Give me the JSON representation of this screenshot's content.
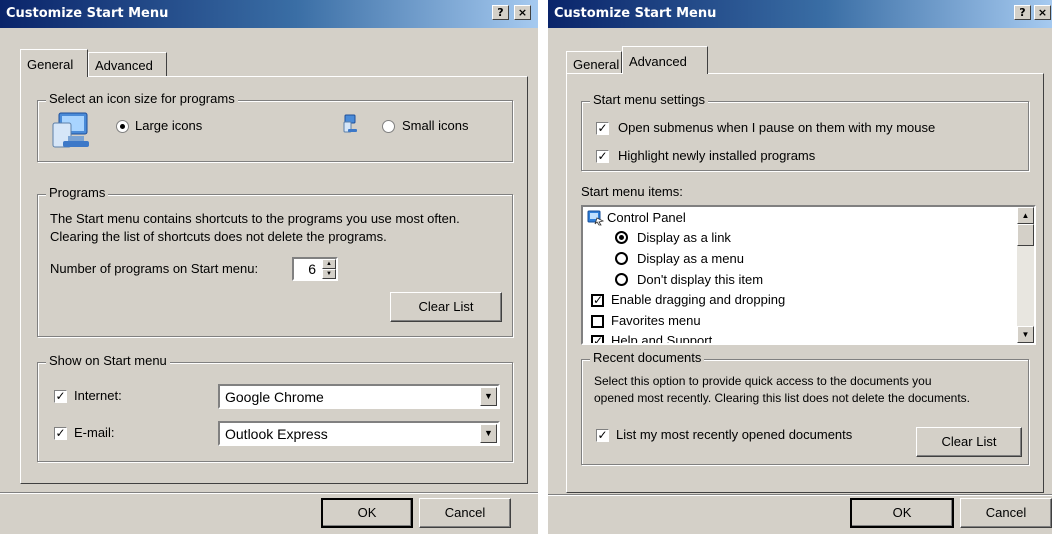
{
  "left": {
    "title": "Customize Start Menu",
    "help_btn": "?",
    "close_btn": "×",
    "tabs": [
      "General",
      "Advanced"
    ],
    "icon_size": {
      "legend": "Select an icon size for programs",
      "large_label": "Large icons",
      "small_label": "Small icons",
      "selected": "large"
    },
    "programs": {
      "legend": "Programs",
      "desc_line1": "The Start menu contains shortcuts to the programs you use most often.",
      "desc_line2": "Clearing the list of shortcuts does not delete the programs.",
      "count_label": "Number of programs on Start menu:",
      "count_value": "6",
      "clear_btn": "Clear List"
    },
    "show": {
      "legend": "Show on Start menu",
      "internet_label": "Internet:",
      "internet_checked": true,
      "internet_value": "Google Chrome",
      "email_label": "E-mail:",
      "email_checked": true,
      "email_value": "Outlook Express"
    },
    "ok": "OK",
    "cancel": "Cancel"
  },
  "right": {
    "title": "Customize Start Menu",
    "help_btn": "?",
    "close_btn": "×",
    "tabs": [
      "General",
      "Advanced"
    ],
    "settings": {
      "legend": "Start menu settings",
      "opt1": "Open submenus when I pause on them with my mouse",
      "opt1_checked": true,
      "opt2": "Highlight newly installed programs",
      "opt2_checked": true
    },
    "items_label": "Start menu items:",
    "items": {
      "control_panel": "Control Panel",
      "as_link": "Display as a link",
      "as_menu": "Display as a menu",
      "dont_display": "Don't display this item",
      "drag_drop": "Enable dragging and dropping",
      "favorites": "Favorites menu",
      "help_support": "Help and Support"
    },
    "recent": {
      "legend": "Recent documents",
      "desc_line1": "Select this option to provide quick access to the documents you",
      "desc_line2": "opened most recently.  Clearing this list does not delete the documents.",
      "list_label": "List my most recently opened documents",
      "list_checked": true,
      "clear_btn": "Clear List"
    },
    "ok": "OK",
    "cancel": "Cancel"
  },
  "colors": {
    "dialog_bg": "#d4d0c8",
    "title_start": "#0a246a",
    "title_end": "#a6caf0",
    "control_panel_icon": "#2f7fd8"
  }
}
